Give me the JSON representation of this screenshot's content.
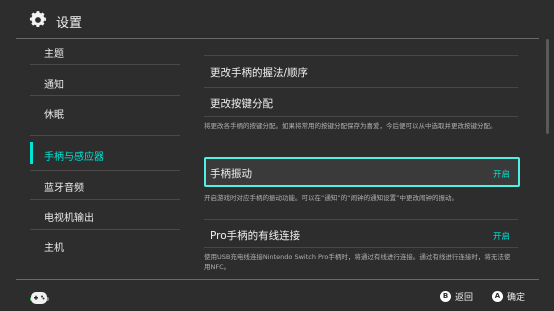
{
  "header": {
    "title": "设置",
    "icon": "gear-icon"
  },
  "sidebar": {
    "items": [
      {
        "label": "主题"
      },
      {
        "label": "通知"
      },
      {
        "label": "休眠"
      },
      {
        "label": "手柄与感应器",
        "active": true
      },
      {
        "label": "蓝牙音频"
      },
      {
        "label": "电视机输出"
      },
      {
        "label": "主机"
      }
    ]
  },
  "content": {
    "rows": [
      {
        "title": "更改手柄的握法/顺序"
      },
      {
        "title": "更改按键分配",
        "description": "将更改各手柄的按键分配。如果将常用的按键分配保存为喜爱，今后便可以从中选取并更改按键分配。"
      },
      {
        "title": "手柄振动",
        "state": "开启",
        "description": "开启游戏时对应手柄的振动功能。可以在“通知”的“闹钟的通知设置”中更改闹钟的振动。"
      },
      {
        "title": "Pro手柄的有线连接",
        "state": "开启",
        "description": "使用USB充电线连接Nintendo Switch Pro手柄时，将通过有线进行连接。通过有线进行连接时，将无法使用NFC。"
      }
    ]
  },
  "footer": {
    "back": {
      "key": "B",
      "label": "返回"
    },
    "ok": {
      "key": "A",
      "label": "确定"
    }
  },
  "colors": {
    "accent": "#00e5d6",
    "background": "#2d2d2d"
  }
}
